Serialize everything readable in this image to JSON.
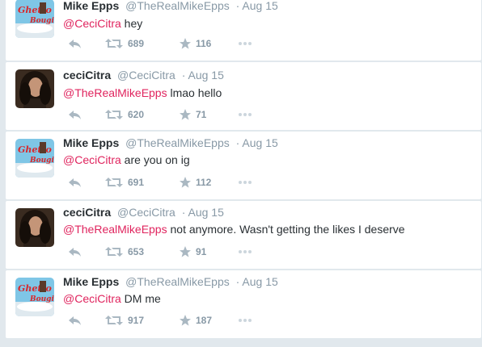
{
  "tweets": [
    {
      "author": "Mike Epps",
      "handle": "@TheRealMikeEpps",
      "date": "· Aug 15",
      "mention": "@CeciCitra",
      "text": " hey",
      "retweets": "689",
      "favorites": "116",
      "avatar_icon": "album-cover-avatar"
    },
    {
      "author": "ceciCitra",
      "handle": "@CeciCitra",
      "date": "· Aug 15",
      "mention": "@TheRealMikeEpps",
      "text": " lmao hello",
      "retweets": "620",
      "favorites": "71",
      "avatar_icon": "portrait-avatar"
    },
    {
      "author": "Mike Epps",
      "handle": "@TheRealMikeEpps",
      "date": "· Aug 15",
      "mention": "@CeciCitra",
      "text": " are you on ig",
      "retweets": "691",
      "favorites": "112",
      "avatar_icon": "album-cover-avatar"
    },
    {
      "author": "ceciCitra",
      "handle": "@CeciCitra",
      "date": "· Aug 15",
      "mention": "@TheRealMikeEpps",
      "text": " not anymore. Wasn't getting the likes I deserve",
      "retweets": "653",
      "favorites": "91",
      "avatar_icon": "portrait-avatar"
    },
    {
      "author": "Mike Epps",
      "handle": "@TheRealMikeEpps",
      "date": "· Aug 15",
      "mention": "@CeciCitra",
      "text": " DM me",
      "retweets": "917",
      "favorites": "187",
      "avatar_icon": "album-cover-avatar"
    }
  ],
  "colors": {
    "mention": "#e0245e",
    "meta": "#8899a6",
    "icon": "#aab8c2",
    "background": "#e1e8ed"
  }
}
